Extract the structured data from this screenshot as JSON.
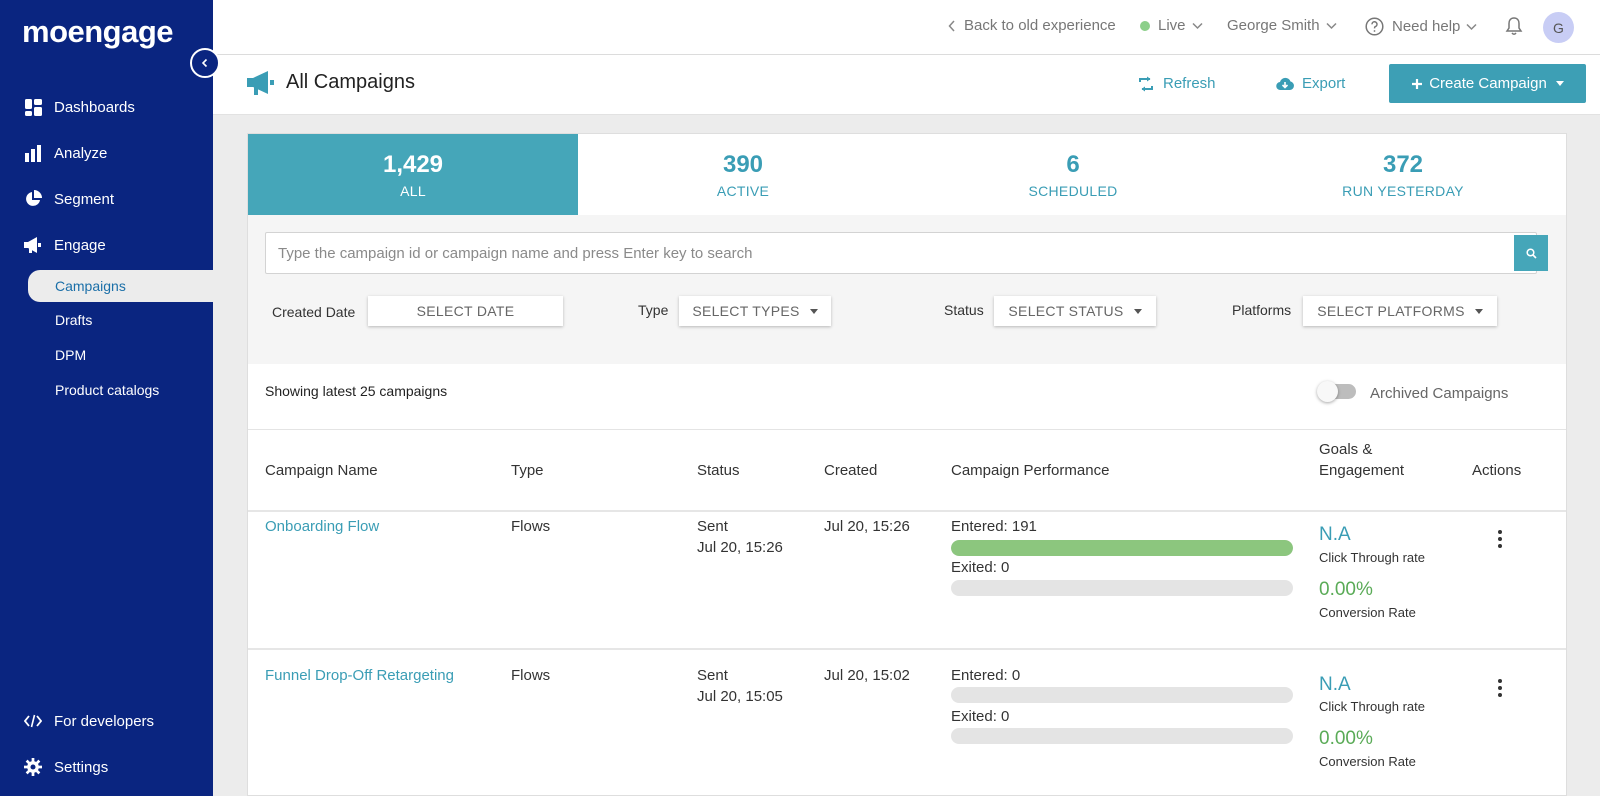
{
  "app": {
    "logo": "moengage"
  },
  "sidebar": {
    "items": [
      {
        "label": "Dashboards",
        "icon": "dashboard-icon"
      },
      {
        "label": "Analyze",
        "icon": "bar-chart-icon"
      },
      {
        "label": "Segment",
        "icon": "pie-chart-icon"
      },
      {
        "label": "Engage",
        "icon": "megaphone-icon"
      }
    ],
    "sub_items": [
      {
        "label": "Campaigns",
        "active": true
      },
      {
        "label": "Drafts"
      },
      {
        "label": "DPM"
      },
      {
        "label": "Product catalogs"
      }
    ],
    "bottom": [
      {
        "label": "For developers",
        "icon": "code-icon"
      },
      {
        "label": "Settings",
        "icon": "gear-icon"
      }
    ]
  },
  "topbar": {
    "back": "Back to old experience",
    "env": "Live",
    "user": "George Smith",
    "help": "Need help",
    "avatar_initial": "G"
  },
  "page": {
    "title": "All Campaigns",
    "refresh": "Refresh",
    "export": "Export",
    "create": "Create Campaign"
  },
  "stats": [
    {
      "num": "1,429",
      "label": "ALL",
      "active": true
    },
    {
      "num": "390",
      "label": "ACTIVE"
    },
    {
      "num": "6",
      "label": "SCHEDULED"
    },
    {
      "num": "372",
      "label": "RUN YESTERDAY"
    }
  ],
  "search": {
    "placeholder": "Type the campaign id or campaign name and press Enter key to search",
    "value": ""
  },
  "filters": {
    "created_date": {
      "label": "Created Date",
      "value": "SELECT DATE"
    },
    "type": {
      "label": "Type",
      "value": "SELECT TYPES"
    },
    "status": {
      "label": "Status",
      "value": "SELECT STATUS"
    },
    "platforms": {
      "label": "Platforms",
      "value": "SELECT PLATFORMS"
    }
  },
  "list": {
    "showing": "Showing latest 25 campaigns",
    "archived_label": "Archived Campaigns",
    "archived_on": false
  },
  "table": {
    "headers": {
      "name": "Campaign Name",
      "type": "Type",
      "status": "Status",
      "created": "Created",
      "performance": "Campaign Performance",
      "goals_line1": "Goals &",
      "goals_line2": "Engagement",
      "actions": "Actions"
    },
    "rows": [
      {
        "name": "Onboarding Flow",
        "type": "Flows",
        "status": "Sent",
        "status_time": "Jul 20, 15:26",
        "created": "Jul 20, 15:26",
        "entered": "Entered: 191",
        "entered_fill": 1.0,
        "exited": "Exited: 0",
        "exited_fill": 0,
        "ctr": "N.A",
        "ctr_label": "Click Through rate",
        "conv": "0.00%",
        "conv_label": "Conversion Rate"
      },
      {
        "name": "Funnel Drop-Off Retargeting",
        "type": "Flows",
        "status": "Sent",
        "status_time": "Jul 20, 15:05",
        "created": "Jul 20, 15:02",
        "entered": "Entered: 0",
        "entered_fill": 0,
        "exited": "Exited: 0",
        "exited_fill": 0,
        "ctr": "N.A",
        "ctr_label": "Click Through rate",
        "conv": "0.00%",
        "conv_label": "Conversion Rate"
      }
    ]
  },
  "colors": {
    "sidebar": "#0a2580",
    "accent": "#45a6b9",
    "link": "#3a9db5",
    "success": "#8cc67e"
  }
}
